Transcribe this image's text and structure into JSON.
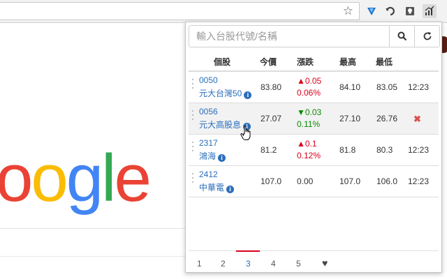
{
  "browser": {
    "star_glyph": "☆"
  },
  "popup": {
    "search_placeholder": "輸入台股代號/名稱",
    "headers": {
      "stock": "個股",
      "price": "今價",
      "change": "漲跌",
      "high": "最高",
      "low": "最低"
    },
    "rows": [
      {
        "code": "0050",
        "name": "元大台灣50",
        "price": "83.80",
        "change": "▲0.05",
        "change_pct": "0.06%",
        "direction": "up",
        "high": "84.10",
        "low": "83.05",
        "time": "12:23",
        "highlighted": false
      },
      {
        "code": "0056",
        "name": "元大高股息",
        "price": "27.07",
        "change": "▼0.03",
        "change_pct": "0.11%",
        "direction": "down",
        "high": "27.10",
        "low": "26.76",
        "time": "",
        "highlighted": true
      },
      {
        "code": "2317",
        "name": "鴻海",
        "price": "81.2",
        "change": "▲0.1",
        "change_pct": "0.12%",
        "direction": "up",
        "high": "81.8",
        "low": "80.3",
        "time": "12:23",
        "highlighted": false
      },
      {
        "code": "2412",
        "name": "中華電",
        "price": "107.0",
        "change": "0.00",
        "change_pct": "",
        "direction": "flat",
        "high": "107.0",
        "low": "106.0",
        "time": "12:23",
        "highlighted": false
      }
    ],
    "remove_glyph": "✖",
    "pages": [
      "1",
      "2",
      "3",
      "4",
      "5"
    ],
    "active_page": "3",
    "favorites_glyph": "♥"
  },
  "google_logo": [
    "o",
    "o",
    "g",
    "l",
    "e"
  ],
  "colors": {
    "up": "#d9001a",
    "down": "#0a8a00",
    "link": "#2a6ebb"
  }
}
